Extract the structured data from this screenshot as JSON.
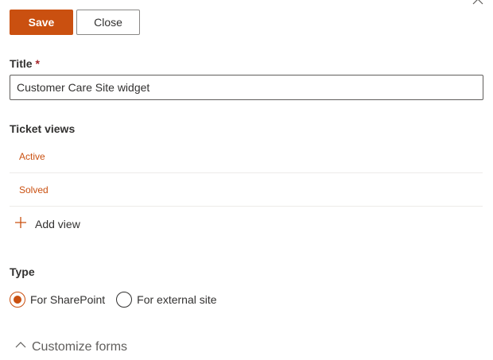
{
  "toolbar": {
    "save_label": "Save",
    "close_label": "Close"
  },
  "title_field": {
    "label": "Title",
    "required_marker": "*",
    "value": "Customer Care Site widget"
  },
  "ticket_views": {
    "label": "Ticket views",
    "items": [
      {
        "label": "Active"
      },
      {
        "label": "Solved"
      }
    ],
    "add_label": "Add view"
  },
  "type_field": {
    "label": "Type",
    "options": [
      {
        "label": "For SharePoint",
        "selected": true
      },
      {
        "label": "For external site",
        "selected": false
      }
    ]
  },
  "customize": {
    "label": "Customize forms",
    "expanded": true
  },
  "colors": {
    "accent": "#ca5010",
    "text": "#323130",
    "divider": "#edebe9"
  },
  "icons": {
    "close": "close-icon",
    "add": "plus-icon",
    "collapse": "chevron-up-icon"
  }
}
